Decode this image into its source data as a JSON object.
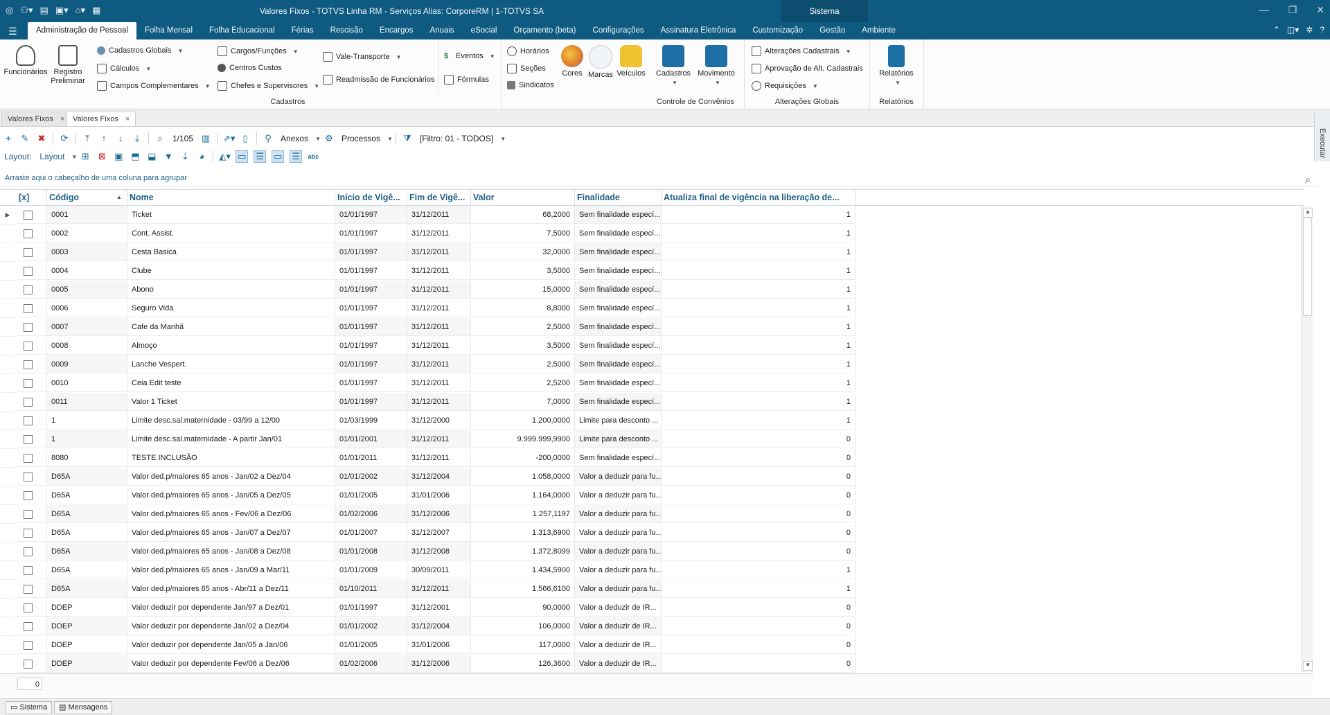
{
  "window": {
    "title": "Valores Fixos - TOTVS Linha RM - Serviços  Alias: CorporeRM | 1-TOTVS SA",
    "system_tab": "Sistema"
  },
  "menu": {
    "tabs": [
      {
        "label": "Administração de Pessoal",
        "active": true
      },
      {
        "label": "Folha Mensal"
      },
      {
        "label": "Folha Educacional"
      },
      {
        "label": "Férias"
      },
      {
        "label": "Rescisão"
      },
      {
        "label": "Encargos"
      },
      {
        "label": "Anuais"
      },
      {
        "label": "eSocial"
      },
      {
        "label": "Orçamento (beta)"
      },
      {
        "label": "Configurações"
      },
      {
        "label": "Assinatura Eletrônica"
      },
      {
        "label": "Customização"
      },
      {
        "label": "Gestão"
      },
      {
        "label": "Ambiente"
      }
    ]
  },
  "ribbon": {
    "big": {
      "funcionarios": "Funcionários",
      "registro1": "Registro",
      "registro2": "Preliminar",
      "cores": "Cores",
      "marcas": "Marcas",
      "veiculos": "Veículos",
      "cadastros": "Cadastros",
      "movimento": "Movimento",
      "relatorios": "Relatórios"
    },
    "small": {
      "cad_globais": "Cadastros Globais",
      "calculos": "Cálculos",
      "campos_compl": "Campos Complementares",
      "cargos": "Cargos/Funções",
      "centros": "Centros Custos",
      "chefes": "Chefes e Supervisores",
      "vale": "Vale-Transporte",
      "readmissao": "Readmissão de Funcionários",
      "eventos": "Eventos",
      "formulas": "Fórmulas",
      "horarios": "Horários",
      "secoes": "Seções",
      "sindicatos": "Sindicatos",
      "alt_cad": "Alterações Cadastrais",
      "aprov": "Aprovação de Alt. Cadastrais",
      "requisicoes": "Requisições"
    },
    "groups": {
      "cadastros": "Cadastros",
      "convenios": "Controle de Convênios",
      "alt_globais": "Alterações Globais",
      "relatorios": "Relatórios"
    }
  },
  "doc_tabs": [
    "Valores Fixos",
    "Valores Fixos"
  ],
  "side_panel": "Executar",
  "toolbar": {
    "pager": "1/105",
    "anexos": "Anexos",
    "processos": "Processos",
    "filtro": "[Filtro: 01 - TODOS]",
    "layout_label": "Layout:",
    "layout_menu": "Layout"
  },
  "group_hint": "Arraste aqui o cabeçalho de uma coluna para agrupar",
  "grid": {
    "columns": [
      "[x]",
      "Código",
      "Nome",
      "Início de Vigê...",
      "Fim de Vigê...",
      "Valor",
      "Finalidade",
      "Atualiza final de vigência na liberação de..."
    ],
    "rows": [
      [
        "0001",
        "Ticket",
        "01/01/1997",
        "31/12/2011",
        "68,2000",
        "Sem finalidade especí...",
        "1"
      ],
      [
        "0002",
        "Cont. Assist.",
        "01/01/1997",
        "31/12/2011",
        "7,5000",
        "Sem finalidade especí...",
        "1"
      ],
      [
        "0003",
        "Cesta Basica",
        "01/01/1997",
        "31/12/2011",
        "32,0000",
        "Sem finalidade especí...",
        "1"
      ],
      [
        "0004",
        "Clube",
        "01/01/1997",
        "31/12/2011",
        "3,5000",
        "Sem finalidade especí...",
        "1"
      ],
      [
        "0005",
        "Abono",
        "01/01/1997",
        "31/12/2011",
        "15,0000",
        "Sem finalidade especí...",
        "1"
      ],
      [
        "0006",
        "Seguro Vida",
        "01/01/1997",
        "31/12/2011",
        "8,8000",
        "Sem finalidade especí...",
        "1"
      ],
      [
        "0007",
        "Cafe da Manhã",
        "01/01/1997",
        "31/12/2011",
        "2,5000",
        "Sem finalidade especí...",
        "1"
      ],
      [
        "0008",
        "Almoço",
        "01/01/1997",
        "31/12/2011",
        "3,5000",
        "Sem finalidade especí...",
        "1"
      ],
      [
        "0009",
        "Lanche Vespert.",
        "01/01/1997",
        "31/12/2011",
        "2,5000",
        "Sem finalidade especí...",
        "1"
      ],
      [
        "0010",
        "Ceia Edit teste",
        "01/01/1997",
        "31/12/2011",
        "2,5200",
        "Sem finalidade especí...",
        "1"
      ],
      [
        "0011",
        "Valor 1 Ticket",
        "01/01/1997",
        "31/12/2011",
        "7,0000",
        "Sem finalidade especí...",
        "1"
      ],
      [
        "1",
        "Limite desc.sal.maternidade - 03/99 a 12/00",
        "01/03/1999",
        "31/12/2000",
        "1.200,0000",
        "Limite para desconto ...",
        "1"
      ],
      [
        "1",
        "Limite desc.sal.maternidade - A partir Jan/01",
        "01/01/2001",
        "31/12/2011",
        "9.999.999,9900",
        "Limite para desconto ...",
        "0"
      ],
      [
        "8080",
        "TESTE INCLUSÃO",
        "01/01/2011",
        "31/12/2011",
        "-200,0000",
        "Sem finalidade especí...",
        "0"
      ],
      [
        "D65A",
        "Valor ded.p/maiores 65 anos - Jan/02 a Dez/04",
        "01/01/2002",
        "31/12/2004",
        "1.058,0000",
        "Valor a deduzir para fu...",
        "0"
      ],
      [
        "D65A",
        "Valor ded.p/maiores 65 anos - Jan/05 a Dez/05",
        "01/01/2005",
        "31/01/2006",
        "1.164,0000",
        "Valor a deduzir para fu...",
        "0"
      ],
      [
        "D65A",
        "Valor ded.p/maiores 65 anos - Fev/06 a Dez/06",
        "01/02/2006",
        "31/12/2006",
        "1.257,1197",
        "Valor a deduzir para fu...",
        "0"
      ],
      [
        "D65A",
        "Valor ded.p/maiores 65 anos - Jan/07 a Dez/07",
        "01/01/2007",
        "31/12/2007",
        "1.313,6900",
        "Valor a deduzir para fu...",
        "0"
      ],
      [
        "D65A",
        "Valor ded.p/maiores 65 anos - Jan/08 a Dez/08",
        "01/01/2008",
        "31/12/2008",
        "1.372,8099",
        "Valor a deduzir para fu...",
        "0"
      ],
      [
        "D65A",
        "Valor ded.p/maiores 65 anos - Jan/09 a Mar/11",
        "01/01/2009",
        "30/09/2011",
        "1.434,5900",
        "Valor a deduzir para fu...",
        "1"
      ],
      [
        "D65A",
        "Valor ded.p/maiores 65 anos - Abr/11 a Dez/11",
        "01/10/2011",
        "31/12/2011",
        "1.566,6100",
        "Valor a deduzir para fu...",
        "1"
      ],
      [
        "DDEP",
        "Valor deduzir por dependente Jan/97 a Dez/01",
        "01/01/1997",
        "31/12/2001",
        "90,0000",
        "Valor a deduzir de IR...",
        "0"
      ],
      [
        "DDEP",
        "Valor deduzir por dependente Jan/02 a Dez/04",
        "01/01/2002",
        "31/12/2004",
        "106,0000",
        "Valor a deduzir de IR...",
        "0"
      ],
      [
        "DDEP",
        "Valor deduzir por dependente Jan/05 a Jan/06",
        "01/01/2005",
        "31/01/2006",
        "117,0000",
        "Valor a deduzir de IR...",
        "0"
      ],
      [
        "DDEP",
        "Valor deduzir por dependente Fev/06 a Dez/06",
        "01/02/2006",
        "31/12/2006",
        "126,3600",
        "Valor a deduzir de IR...",
        "0"
      ]
    ]
  },
  "footer_count": "0",
  "statusbar": [
    "Sistema",
    "Mensagens"
  ]
}
